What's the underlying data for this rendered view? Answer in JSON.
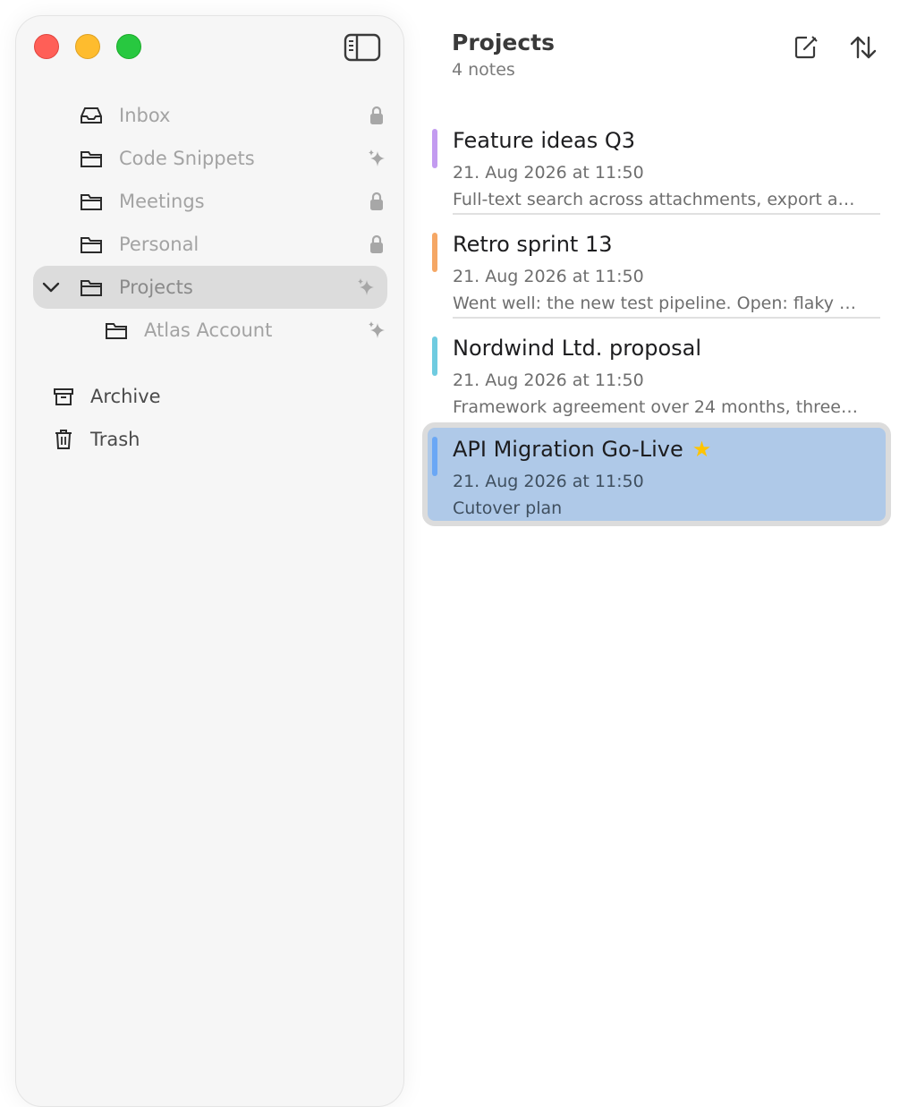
{
  "sidebar": {
    "folders": [
      {
        "label": "Inbox",
        "icon": "inbox-icon",
        "badge": "lock-icon"
      },
      {
        "label": "Code Snippets",
        "icon": "folder-icon",
        "badge": "sparkle-icon"
      },
      {
        "label": "Meetings",
        "icon": "folder-icon",
        "badge": "lock-icon"
      },
      {
        "label": "Personal",
        "icon": "folder-icon",
        "badge": "lock-icon"
      },
      {
        "label": "Projects",
        "icon": "folder-icon",
        "badge": "sparkle-icon",
        "selected": true,
        "expanded": true
      },
      {
        "label": "Atlas Account",
        "icon": "folder-icon",
        "badge": "sparkle-icon"
      }
    ],
    "system": [
      {
        "label": "Archive",
        "icon": "archive-icon"
      },
      {
        "label": "Trash",
        "icon": "trash-icon"
      }
    ]
  },
  "list": {
    "title": "Projects",
    "count": "4 notes",
    "notes": [
      {
        "title": "Feature ideas Q3",
        "date": "21. Aug 2026 at 11:50",
        "preview": "Full-text search across attachments, export a…",
        "color": "#c39bf0"
      },
      {
        "title": "Retro sprint 13",
        "date": "21. Aug 2026 at 11:50",
        "preview": "Went well: the new test pipeline. Open: flaky t…",
        "color": "#f5a765"
      },
      {
        "title": "Nordwind Ltd. proposal",
        "date": "21. Aug 2026 at 11:50",
        "preview": "Framework agreement over 24 months, three…",
        "color": "#6fcbe0"
      },
      {
        "title": "API Migration Go-Live",
        "date": "21. Aug 2026 at 11:50",
        "preview": "Cutover plan",
        "color": "#6aa7f5",
        "starred": true,
        "selected": true
      }
    ]
  },
  "colors": {
    "accent_selection": "#afc9e8",
    "sidebar_bg": "#f6f6f6"
  }
}
